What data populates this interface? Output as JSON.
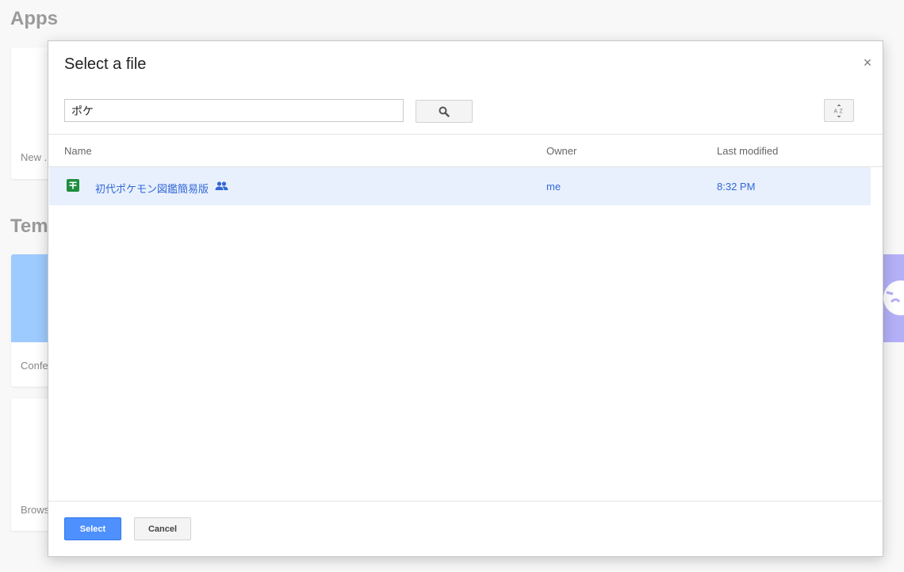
{
  "background": {
    "apps_heading": "Apps",
    "templates_heading": "Tem",
    "card_new_label": "New .",
    "card_conf_label": "Confe",
    "card_browse_label": "Brows"
  },
  "dialog": {
    "title": "Select a file",
    "close_glyph": "×",
    "search": {
      "value": "ポケ",
      "icon": "search-icon"
    },
    "sort_icon": "az-sort-icon",
    "columns": {
      "name": "Name",
      "owner": "Owner",
      "modified": "Last modified"
    },
    "files": [
      {
        "name": "初代ポケモン図鑑簡易版",
        "type": "spreadsheet",
        "shared": true,
        "owner": "me",
        "modified": "8:32 PM",
        "selected": true
      }
    ],
    "select_label": "Select",
    "cancel_label": "Cancel"
  },
  "colors": {
    "accent": "#4d90fe",
    "link": "#3367d6",
    "selected_row": "#e8f0fe",
    "sheets_green": "#1e8e3e"
  }
}
